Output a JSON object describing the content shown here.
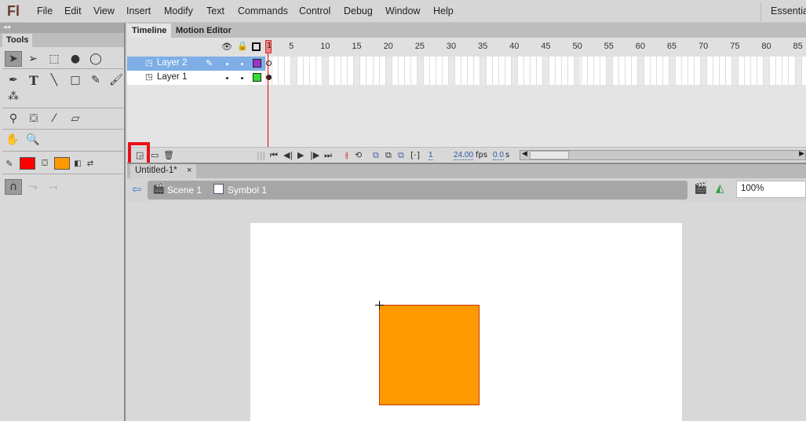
{
  "app": {
    "logo": "Fl",
    "workspace": "Essential"
  },
  "menu": [
    "File",
    "Edit",
    "View",
    "Insert",
    "Modify",
    "Text",
    "Commands",
    "Control",
    "Debug",
    "Window",
    "Help"
  ],
  "tools_panel": {
    "collapse_glyph": "◂◂",
    "tab": "Tools",
    "tools": [
      "selection",
      "subselection",
      "free-transform",
      "3d-rotation",
      "lasso",
      "pen",
      "text",
      "line",
      "rectangle",
      "pencil",
      "brush",
      "deco",
      "bone",
      "paint-bucket",
      "eyedropper",
      "eraser",
      "hand",
      "zoom"
    ],
    "stroke_color": "#ff0000",
    "fill_color": "#ff9900",
    "options": [
      "snap-to-objects",
      "smooth",
      "straighten"
    ]
  },
  "timeline": {
    "tabs": [
      "Timeline",
      "Motion Editor"
    ],
    "active_tab": "Timeline",
    "layers": [
      {
        "name": "Layer 2",
        "selected": true,
        "color": "#9933cc"
      },
      {
        "name": "Layer 1",
        "selected": false,
        "color": "#33dd33"
      }
    ],
    "ruler": [
      "1",
      "5",
      "10",
      "15",
      "20",
      "25",
      "30",
      "35",
      "40",
      "45",
      "50",
      "55",
      "60",
      "65",
      "70",
      "75",
      "80",
      "85"
    ],
    "current_frame": "1",
    "fps": "24.00",
    "fps_unit": "fps",
    "elapsed": "0.0",
    "elapsed_unit": "s"
  },
  "document": {
    "tab": "Untitled-1*",
    "close_glyph": "×",
    "breadcrumb": [
      "Scene 1",
      "Symbol 1"
    ],
    "zoom": "100%"
  },
  "stage": {
    "shape_fill": "#ff9900",
    "shape_stroke": "#cc3300"
  }
}
